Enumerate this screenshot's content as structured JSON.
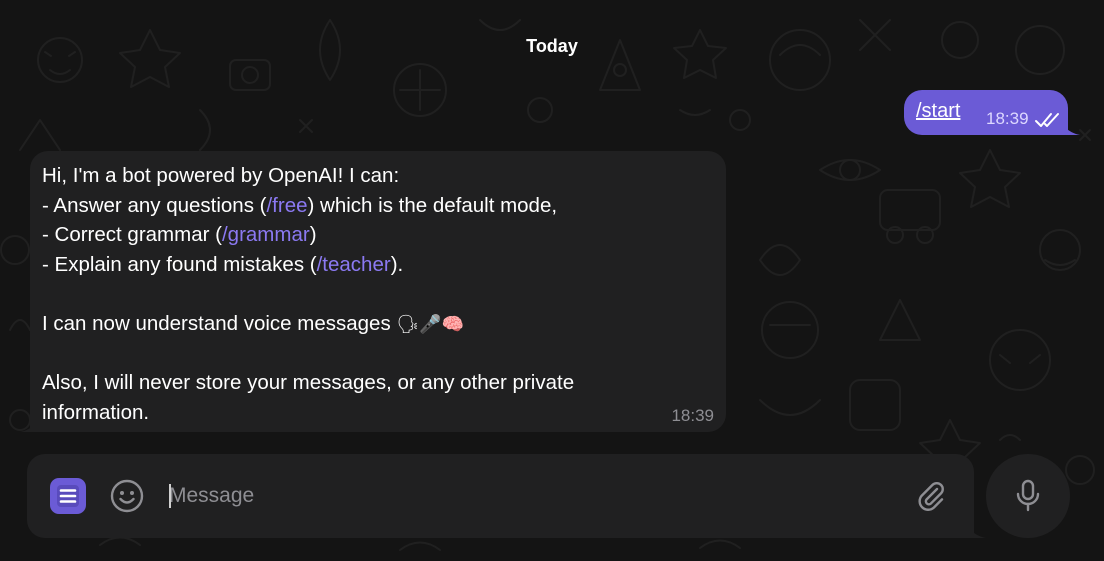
{
  "chat": {
    "date_label": "Today"
  },
  "outgoing_message": {
    "text": "/start",
    "time": "18:39",
    "status_icon": "double-check-icon"
  },
  "incoming_message": {
    "lines": {
      "l1": "Hi, I'm a bot powered by OpenAI! I can:",
      "l2_pre": "- Answer any questions (",
      "l2_cmd": "/free",
      "l2_post": ") which is the default mode,",
      "l3_pre": "- Correct grammar (",
      "l3_cmd": "/grammar",
      "l3_post": ")",
      "l4_pre": "- Explain any found mistakes (",
      "l4_cmd": "/teacher",
      "l4_post": ").",
      "l6": "I can now understand voice messages ",
      "l6_emoji": "🗣🎤🧠",
      "l8": "Also, I will never store your messages, or any other private",
      "l9": "information."
    },
    "time": "18:39"
  },
  "composer": {
    "placeholder": "Message",
    "value": "",
    "menu_icon": "menu-icon",
    "emoji_icon": "smiley-icon",
    "attach_icon": "paperclip-icon",
    "voice_icon": "microphone-icon"
  },
  "colors": {
    "accent": "#6b5bd6",
    "command_link": "#8b79f2",
    "bubble_incoming": "#202021",
    "background": "#141414"
  }
}
